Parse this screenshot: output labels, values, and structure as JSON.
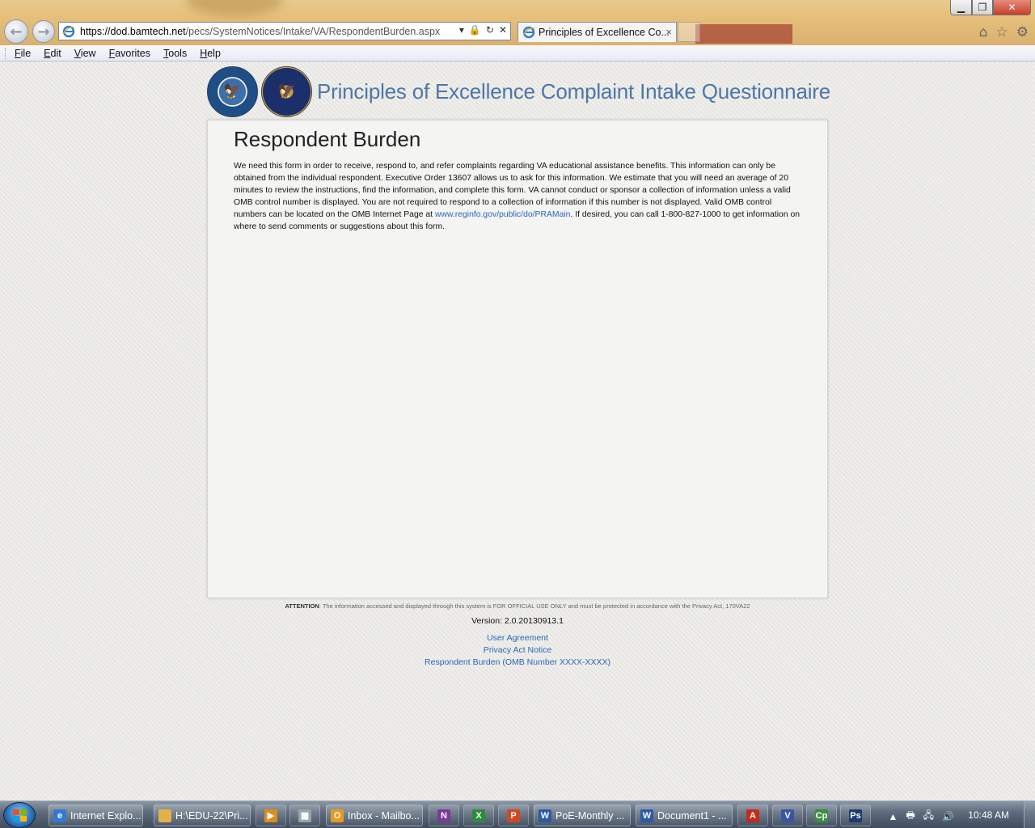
{
  "browser": {
    "url_prefix": "https://",
    "url_domain": "dod.bamtech.net",
    "url_path": "/pecs/SystemNotices/Intake/VA/RespondentBurden.aspx",
    "tab_title": "Principles of Excellence Co...",
    "tab_close": "×",
    "menu": [
      "File",
      "Edit",
      "View",
      "Favorites",
      "Tools",
      "Help"
    ],
    "window_controls": {
      "minimize": "▁",
      "maximize": "❐",
      "close": "✕"
    }
  },
  "site": {
    "title": "Principles of Excellence Complaint Intake Questionnaire"
  },
  "content": {
    "heading": "Respondent Burden",
    "body_part1": "We need this form in order to receive, respond to, and refer complaints regarding VA educational assistance benefits. This information can only be obtained from the individual respondent. Executive Order 13607 allows us to ask for this information. We estimate that you will need an average of 20 minutes to review the instructions, find the information, and complete this form. VA cannot conduct or sponsor a collection of information unless a valid OMB control number is displayed. You are not required to respond to a collection of information if this number is not displayed. Valid OMB control numbers can be located on the OMB Internet Page at ",
    "link": "www.reginfo.gov/public/do/PRAMain",
    "body_part2": ". If desired, you can call 1-800-827-1000 to get information on where to send comments or suggestions about this form."
  },
  "footer": {
    "attention_label": "ATTENTION",
    "attention_text": ": The information accessed and displayed through this system is FOR OFFICIAL USE ONLY and must be protected in accordance with the Privacy Act, 170VA22",
    "version": "Version: 2.0.20130913.1",
    "links": [
      "User Agreement",
      "Privacy Act Notice",
      "Respondent Burden (OMB Number XXXX-XXXX)"
    ]
  },
  "taskbar": {
    "buttons": [
      {
        "label": "Internet Explo...",
        "icon": "ie-icon",
        "color": "#2f7bd4"
      },
      {
        "label": "H:\\EDU-22\\Pri...",
        "icon": "folder-icon",
        "color": "#e3b14a"
      },
      {
        "label": "Inbox - Mailbo...",
        "icon": "outlook-icon",
        "color": "#e69b1f"
      },
      {
        "label": "PoE-Monthly ...",
        "icon": "word-icon",
        "color": "#2b5aa8"
      },
      {
        "label": "Document1 - ...",
        "icon": "word-icon",
        "color": "#2b5aa8"
      }
    ],
    "clock": "10:48 AM"
  }
}
